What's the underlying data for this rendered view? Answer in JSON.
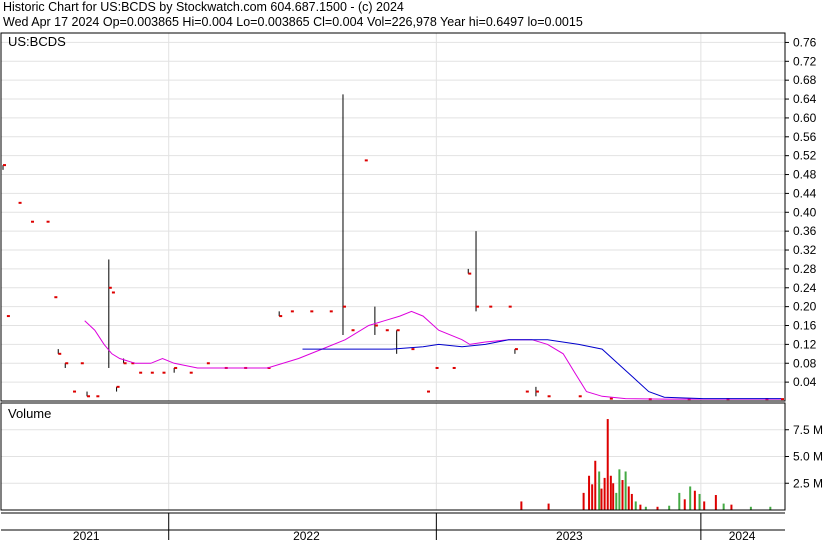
{
  "header": {
    "line1": "Historic Chart for US:BCDS by Stockwatch.com 604.687.1500 - (c) 2024",
    "line2": "Wed Apr 17 2024   Op=0.003865   Hi=0.004   Lo=0.003865   Cl=0.004   Vol=226,978   Year hi=0.6497   lo=0.0015"
  },
  "chart_data": [
    {
      "type": "line",
      "title": "US:BCDS",
      "ylim": [
        0,
        0.78
      ],
      "y_ticks": [
        "0.76",
        "0.72",
        "0.68",
        "0.64",
        "0.60",
        "0.56",
        "0.52",
        "0.48",
        "0.44",
        "0.40",
        "0.36",
        "0.32",
        "0.28",
        "0.24",
        "0.20",
        "0.16",
        "0.12",
        "0.08",
        "0.04"
      ],
      "x_ticks": [
        "2021",
        "2022",
        "2023",
        "2024"
      ],
      "grid": true,
      "price_bars": [
        {
          "t": 0.0,
          "hi": 0.5,
          "lo": 0.49,
          "cl": 0.5
        },
        {
          "t": 0.005,
          "hi": 0.18,
          "lo": 0.18,
          "cl": 0.18
        },
        {
          "t": 0.02,
          "hi": 0.42,
          "lo": 0.42,
          "cl": 0.42
        },
        {
          "t": 0.036,
          "hi": 0.38,
          "lo": 0.38,
          "cl": 0.38
        },
        {
          "t": 0.056,
          "hi": 0.38,
          "lo": 0.38,
          "cl": 0.38
        },
        {
          "t": 0.066,
          "hi": 0.22,
          "lo": 0.22,
          "cl": 0.22
        },
        {
          "t": 0.071,
          "hi": 0.11,
          "lo": 0.1,
          "cl": 0.1
        },
        {
          "t": 0.08,
          "hi": 0.08,
          "lo": 0.07,
          "cl": 0.08
        },
        {
          "t": 0.09,
          "hi": 0.02,
          "lo": 0.02,
          "cl": 0.02
        },
        {
          "t": 0.1,
          "hi": 0.08,
          "lo": 0.08,
          "cl": 0.08
        },
        {
          "t": 0.108,
          "hi": 0.02,
          "lo": 0.01,
          "cl": 0.01
        },
        {
          "t": 0.12,
          "hi": 0.01,
          "lo": 0.01,
          "cl": 0.01
        },
        {
          "t": 0.136,
          "hi": 0.3,
          "lo": 0.07,
          "cl": 0.24
        },
        {
          "t": 0.14,
          "hi": 0.23,
          "lo": 0.23,
          "cl": 0.23
        },
        {
          "t": 0.146,
          "hi": 0.03,
          "lo": 0.02,
          "cl": 0.03
        },
        {
          "t": 0.155,
          "hi": 0.09,
          "lo": 0.08,
          "cl": 0.08
        },
        {
          "t": 0.165,
          "hi": 0.08,
          "lo": 0.08,
          "cl": 0.08
        },
        {
          "t": 0.175,
          "hi": 0.06,
          "lo": 0.06,
          "cl": 0.06
        },
        {
          "t": 0.19,
          "hi": 0.06,
          "lo": 0.06,
          "cl": 0.06
        },
        {
          "t": 0.205,
          "hi": 0.06,
          "lo": 0.06,
          "cl": 0.06
        },
        {
          "t": 0.22,
          "hi": 0.07,
          "lo": 0.06,
          "cl": 0.07
        },
        {
          "t": 0.24,
          "hi": 0.06,
          "lo": 0.06,
          "cl": 0.06
        },
        {
          "t": 0.262,
          "hi": 0.08,
          "lo": 0.08,
          "cl": 0.08
        },
        {
          "t": 0.285,
          "hi": 0.07,
          "lo": 0.07,
          "cl": 0.07
        },
        {
          "t": 0.31,
          "hi": 0.07,
          "lo": 0.07,
          "cl": 0.07
        },
        {
          "t": 0.34,
          "hi": 0.07,
          "lo": 0.07,
          "cl": 0.07
        },
        {
          "t": 0.355,
          "hi": 0.19,
          "lo": 0.18,
          "cl": 0.18
        },
        {
          "t": 0.37,
          "hi": 0.19,
          "lo": 0.19,
          "cl": 0.19
        },
        {
          "t": 0.395,
          "hi": 0.19,
          "lo": 0.19,
          "cl": 0.19
        },
        {
          "t": 0.42,
          "hi": 0.19,
          "lo": 0.19,
          "cl": 0.19
        },
        {
          "t": 0.437,
          "hi": 0.65,
          "lo": 0.14,
          "cl": 0.2
        },
        {
          "t": 0.448,
          "hi": 0.15,
          "lo": 0.15,
          "cl": 0.15
        },
        {
          "t": 0.465,
          "hi": 0.51,
          "lo": 0.51,
          "cl": 0.51
        },
        {
          "t": 0.478,
          "hi": 0.2,
          "lo": 0.14,
          "cl": 0.16
        },
        {
          "t": 0.492,
          "hi": 0.15,
          "lo": 0.15,
          "cl": 0.15
        },
        {
          "t": 0.506,
          "hi": 0.15,
          "lo": 0.1,
          "cl": 0.15
        },
        {
          "t": 0.525,
          "hi": 0.11,
          "lo": 0.11,
          "cl": 0.11
        },
        {
          "t": 0.545,
          "hi": 0.02,
          "lo": 0.02,
          "cl": 0.02
        },
        {
          "t": 0.556,
          "hi": 0.07,
          "lo": 0.07,
          "cl": 0.07
        },
        {
          "t": 0.578,
          "hi": 0.07,
          "lo": 0.07,
          "cl": 0.07
        },
        {
          "t": 0.598,
          "hi": 0.28,
          "lo": 0.27,
          "cl": 0.27
        },
        {
          "t": 0.608,
          "hi": 0.36,
          "lo": 0.19,
          "cl": 0.2
        },
        {
          "t": 0.625,
          "hi": 0.2,
          "lo": 0.2,
          "cl": 0.2
        },
        {
          "t": 0.65,
          "hi": 0.2,
          "lo": 0.2,
          "cl": 0.2
        },
        {
          "t": 0.658,
          "hi": 0.11,
          "lo": 0.1,
          "cl": 0.11
        },
        {
          "t": 0.672,
          "hi": 0.02,
          "lo": 0.02,
          "cl": 0.02
        },
        {
          "t": 0.685,
          "hi": 0.03,
          "lo": 0.01,
          "cl": 0.02
        },
        {
          "t": 0.7,
          "hi": 0.01,
          "lo": 0.01,
          "cl": 0.01
        },
        {
          "t": 0.74,
          "hi": 0.01,
          "lo": 0.01,
          "cl": 0.01
        },
        {
          "t": 0.78,
          "hi": 0.008,
          "lo": 0.004,
          "cl": 0.005
        },
        {
          "t": 0.83,
          "hi": 0.005,
          "lo": 0.003,
          "cl": 0.004
        },
        {
          "t": 0.88,
          "hi": 0.005,
          "lo": 0.003,
          "cl": 0.004
        },
        {
          "t": 0.93,
          "hi": 0.005,
          "lo": 0.003,
          "cl": 0.004
        },
        {
          "t": 0.98,
          "hi": 0.005,
          "lo": 0.003,
          "cl": 0.004
        },
        {
          "t": 1.0,
          "hi": 0.004,
          "lo": 0.0039,
          "cl": 0.004
        }
      ],
      "series": [
        {
          "color": "#dd00dd",
          "points": [
            [
              0.105,
              0.17
            ],
            [
              0.118,
              0.15
            ],
            [
              0.13,
              0.12
            ],
            [
              0.14,
              0.1
            ],
            [
              0.15,
              0.09
            ],
            [
              0.17,
              0.08
            ],
            [
              0.19,
              0.08
            ],
            [
              0.205,
              0.09
            ],
            [
              0.22,
              0.08
            ],
            [
              0.25,
              0.07
            ],
            [
              0.3,
              0.07
            ],
            [
              0.34,
              0.07
            ],
            [
              0.38,
              0.09
            ],
            [
              0.41,
              0.11
            ],
            [
              0.44,
              0.13
            ],
            [
              0.47,
              0.16
            ],
            [
              0.49,
              0.17
            ],
            [
              0.51,
              0.18
            ],
            [
              0.525,
              0.19
            ],
            [
              0.54,
              0.18
            ],
            [
              0.56,
              0.15
            ],
            [
              0.59,
              0.13
            ],
            [
              0.6,
              0.12
            ],
            [
              0.62,
              0.125
            ],
            [
              0.65,
              0.13
            ],
            [
              0.68,
              0.13
            ],
            [
              0.7,
              0.12
            ],
            [
              0.72,
              0.1
            ],
            [
              0.735,
              0.06
            ],
            [
              0.75,
              0.02
            ],
            [
              0.77,
              0.01
            ],
            [
              0.8,
              0.005
            ],
            [
              0.85,
              0.004
            ],
            [
              0.9,
              0.004
            ],
            [
              0.95,
              0.004
            ],
            [
              1.0,
              0.004
            ]
          ]
        },
        {
          "color": "#0000cc",
          "points": [
            [
              0.385,
              0.11
            ],
            [
              0.42,
              0.11
            ],
            [
              0.46,
              0.11
            ],
            [
              0.5,
              0.11
            ],
            [
              0.54,
              0.115
            ],
            [
              0.56,
              0.12
            ],
            [
              0.59,
              0.115
            ],
            [
              0.62,
              0.12
            ],
            [
              0.65,
              0.13
            ],
            [
              0.7,
              0.13
            ],
            [
              0.74,
              0.12
            ],
            [
              0.77,
              0.11
            ],
            [
              0.79,
              0.08
            ],
            [
              0.81,
              0.05
            ],
            [
              0.83,
              0.02
            ],
            [
              0.85,
              0.008
            ],
            [
              0.9,
              0.005
            ],
            [
              0.95,
              0.005
            ],
            [
              1.0,
              0.005
            ]
          ]
        }
      ]
    },
    {
      "type": "bar",
      "title": "Volume",
      "ylim": [
        0,
        10
      ],
      "y_ticks": [
        "7.5 M",
        "5.0 M",
        "2.5 M"
      ],
      "bars": [
        {
          "t": 0.665,
          "v": 0.8,
          "color": "#dd0000"
        },
        {
          "t": 0.7,
          "v": 0.6,
          "color": "#dd0000"
        },
        {
          "t": 0.745,
          "v": 1.6,
          "color": "#dd0000"
        },
        {
          "t": 0.752,
          "v": 3.2,
          "color": "#dd0000"
        },
        {
          "t": 0.756,
          "v": 2.4,
          "color": "#dd0000"
        },
        {
          "t": 0.76,
          "v": 4.6,
          "color": "#dd0000"
        },
        {
          "t": 0.765,
          "v": 3.6,
          "color": "#44aa44"
        },
        {
          "t": 0.768,
          "v": 2.0,
          "color": "#dd0000"
        },
        {
          "t": 0.772,
          "v": 3.0,
          "color": "#dd0000"
        },
        {
          "t": 0.776,
          "v": 8.5,
          "color": "#dd0000"
        },
        {
          "t": 0.78,
          "v": 3.2,
          "color": "#dd0000"
        },
        {
          "t": 0.783,
          "v": 2.5,
          "color": "#dd0000"
        },
        {
          "t": 0.787,
          "v": 1.6,
          "color": "#44aa44"
        },
        {
          "t": 0.791,
          "v": 3.8,
          "color": "#44aa44"
        },
        {
          "t": 0.795,
          "v": 2.8,
          "color": "#dd0000"
        },
        {
          "t": 0.799,
          "v": 3.6,
          "color": "#44aa44"
        },
        {
          "t": 0.803,
          "v": 2.2,
          "color": "#dd0000"
        },
        {
          "t": 0.807,
          "v": 1.5,
          "color": "#dd0000"
        },
        {
          "t": 0.812,
          "v": 0.8,
          "color": "#44aa44"
        },
        {
          "t": 0.818,
          "v": 0.5,
          "color": "#dd0000"
        },
        {
          "t": 0.825,
          "v": 0.3,
          "color": "#44aa44"
        },
        {
          "t": 0.84,
          "v": 0.3,
          "color": "#dd0000"
        },
        {
          "t": 0.855,
          "v": 0.4,
          "color": "#44aa44"
        },
        {
          "t": 0.868,
          "v": 1.6,
          "color": "#44aa44"
        },
        {
          "t": 0.875,
          "v": 1.0,
          "color": "#dd0000"
        },
        {
          "t": 0.882,
          "v": 2.2,
          "color": "#44aa44"
        },
        {
          "t": 0.888,
          "v": 1.8,
          "color": "#dd0000"
        },
        {
          "t": 0.894,
          "v": 1.5,
          "color": "#44aa44"
        },
        {
          "t": 0.9,
          "v": 0.8,
          "color": "#dd0000"
        },
        {
          "t": 0.915,
          "v": 1.4,
          "color": "#dd0000"
        },
        {
          "t": 0.925,
          "v": 0.6,
          "color": "#44aa44"
        },
        {
          "t": 0.935,
          "v": 0.5,
          "color": "#dd0000"
        },
        {
          "t": 0.96,
          "v": 0.3,
          "color": "#44aa44"
        },
        {
          "t": 0.985,
          "v": 0.3,
          "color": "#44aa44"
        }
      ]
    }
  ]
}
